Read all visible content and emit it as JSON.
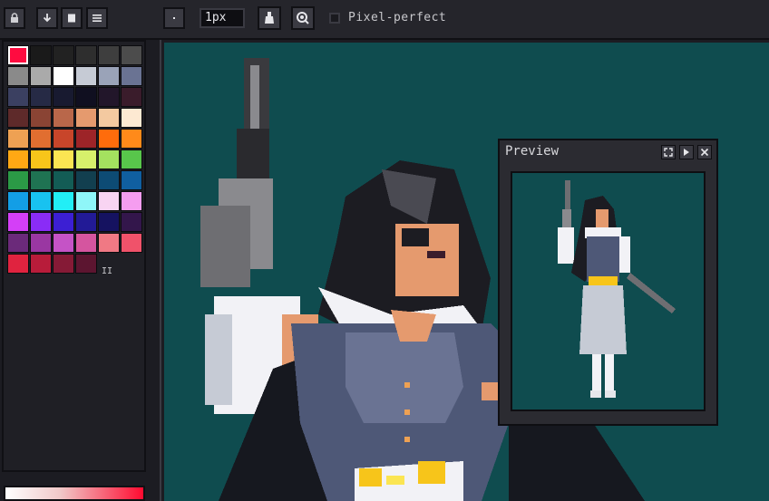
{
  "toolbar": {
    "brush_size": "1px",
    "pixel_perfect_label": "Pixel-perfect",
    "pixel_perfect_checked": false,
    "icons": [
      "lock-icon",
      "arrow-down-icon",
      "file-icon",
      "menu-icon",
      "dot-brush-icon",
      "fill-bucket-icon",
      "magnifier-icon"
    ]
  },
  "palette": {
    "selected_index": 0,
    "colors": [
      "#ff0b40",
      "#1a1a1a",
      "#222222",
      "#2e2e2e",
      "#3e3e3e",
      "#4c4c4c",
      "#8a8a8a",
      "#aaaaaa",
      "#ffffff",
      "#c6cbd5",
      "#9aa3b8",
      "#6a7393",
      "#3b4061",
      "#262a45",
      "#181a30",
      "#100f20",
      "#22162a",
      "#3a1c2b",
      "#5e2a2a",
      "#8a4434",
      "#b9674a",
      "#e59a6e",
      "#f3c9a0",
      "#fde9d2",
      "#eea153",
      "#e16e30",
      "#c8452a",
      "#9d2428",
      "#ff6c0c",
      "#ff8a1a",
      "#ffa814",
      "#f7c51a",
      "#fbe552",
      "#d7f06b",
      "#a4e15f",
      "#58c64b",
      "#2b9a46",
      "#1f7352",
      "#135c55",
      "#123f4f",
      "#0d4b74",
      "#105fa0",
      "#139ee6",
      "#18c2f0",
      "#22eef6",
      "#8ff6f8",
      "#f8d4f2",
      "#f59df0",
      "#d43ff7",
      "#8a2cf6",
      "#3c1fd3",
      "#221a96",
      "#151260",
      "#33164b",
      "#6b2a7a",
      "#9a37a2",
      "#c553c6",
      "#d5559f",
      "#f07984",
      "#f0526a",
      "#e0233f",
      "#b81c3a",
      "#851a36",
      "#5c1530"
    ]
  },
  "preview": {
    "title": "Preview",
    "icons": [
      "fullscreen-icon",
      "play-icon",
      "close-icon"
    ]
  },
  "colors": {
    "canvas_bg": "#0f4c4f",
    "panel_bg": "#1f1f25",
    "toolbar_bg": "#25252b"
  }
}
